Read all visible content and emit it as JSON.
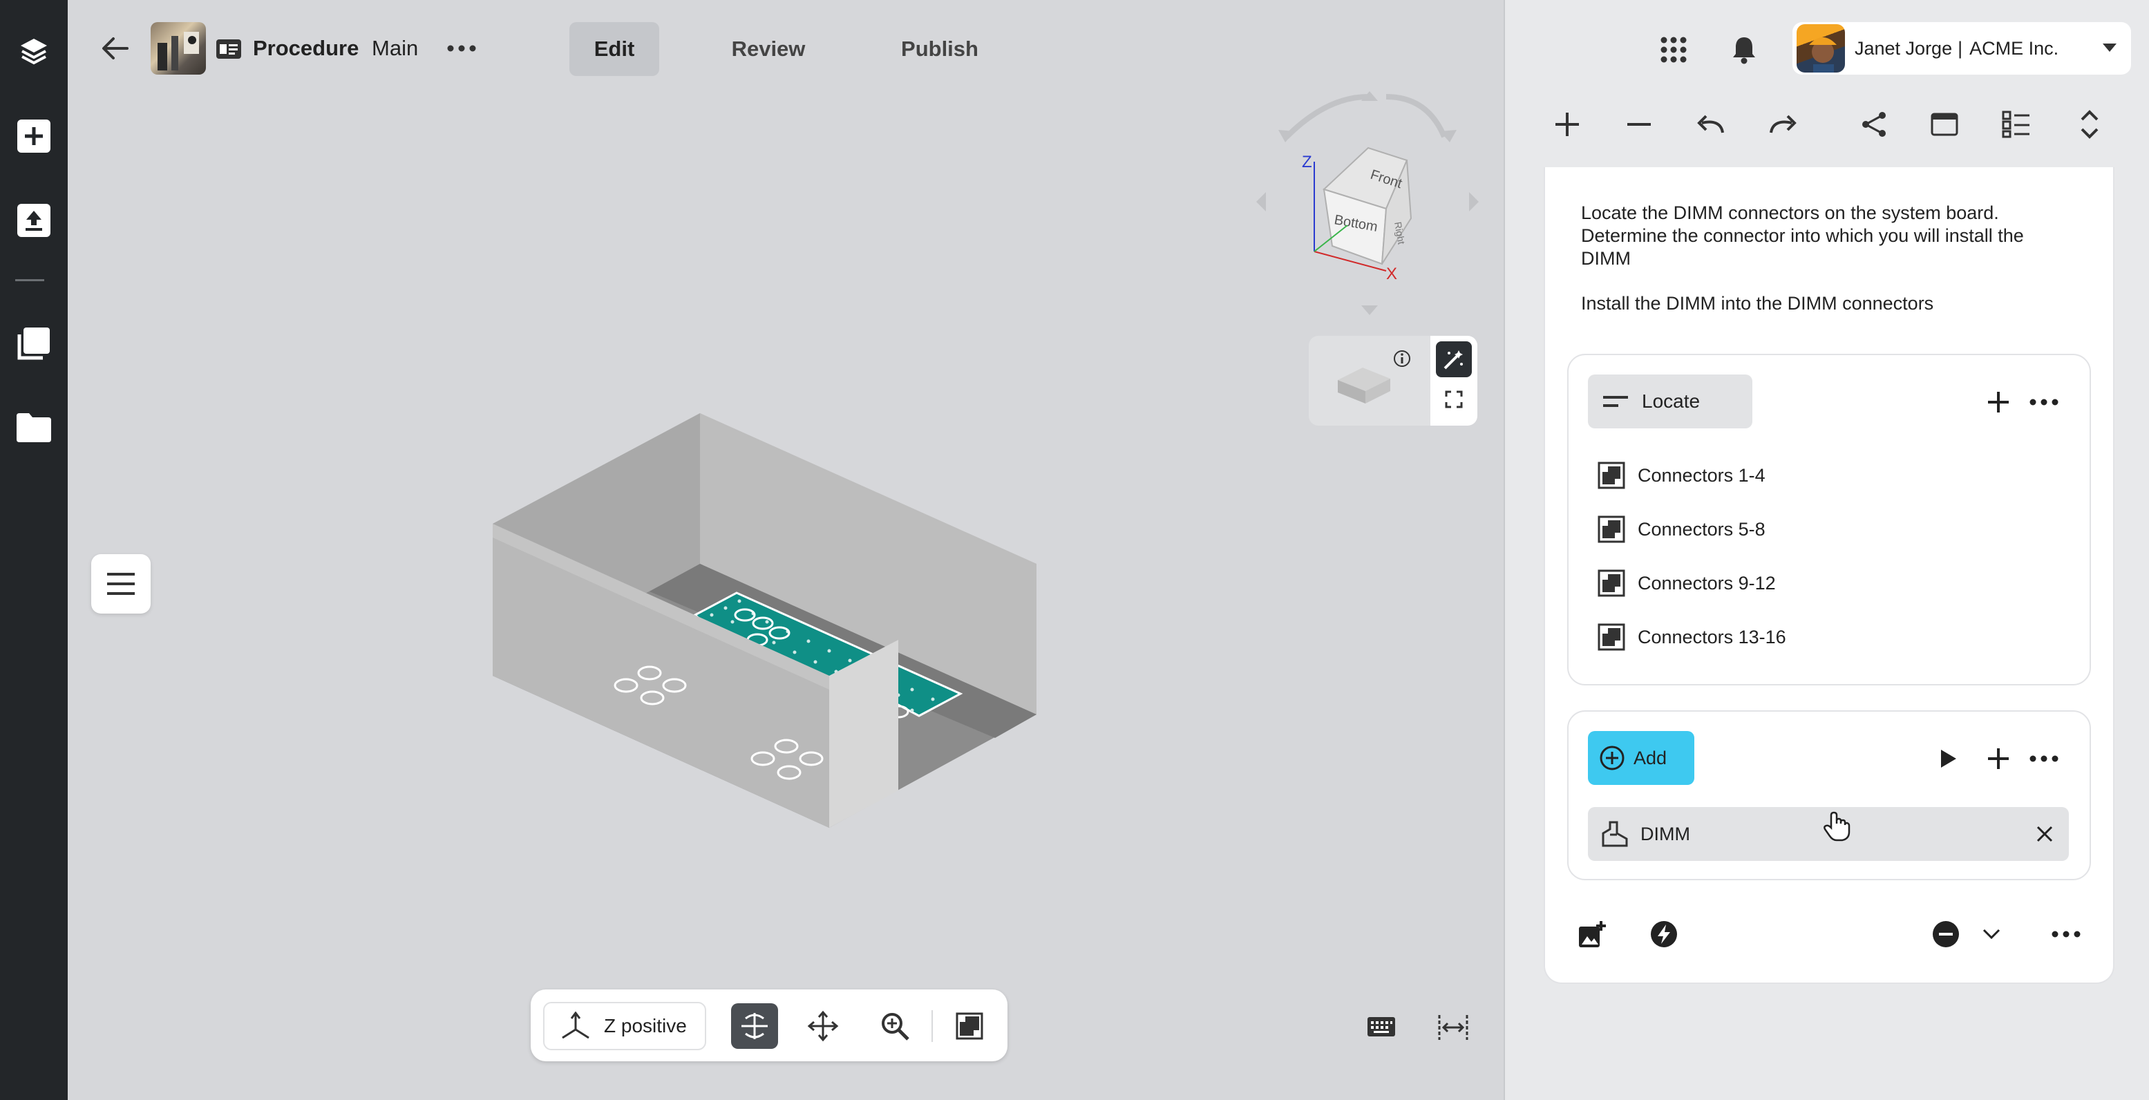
{
  "header": {
    "title": "Procedure",
    "subtitle": "Main",
    "tabs": [
      {
        "label": "Edit"
      },
      {
        "label": "Review"
      },
      {
        "label": "Publish"
      }
    ]
  },
  "user": {
    "name": "Janet Jorge",
    "separator": "|",
    "org": "ACME Inc."
  },
  "view_cube": {
    "faces": {
      "front": "Front",
      "bottom": "Bottom",
      "right": "Right"
    },
    "axes": {
      "x": "X",
      "z": "Z"
    }
  },
  "bottom_toolbar": {
    "view_label": "Z positive"
  },
  "panel": {
    "description_1": "Locate the DIMM connectors on the system board. Determine the connector into which you will install the DIMM",
    "description_2": "Install the DIMM into the DIMM connectors",
    "locate_chip": "Locate",
    "connectors": [
      {
        "label": "Connectors 1-4"
      },
      {
        "label": "Connectors 5-8"
      },
      {
        "label": "Connectors 9-12"
      },
      {
        "label": "Connectors 13-16"
      }
    ],
    "add_label": "Add",
    "part_label": "DIMM"
  },
  "colors": {
    "rail": "#232629",
    "viewport": "#d6d7da",
    "accent_cyan": "#3ec9f0",
    "board_teal": "#0f8f86"
  }
}
